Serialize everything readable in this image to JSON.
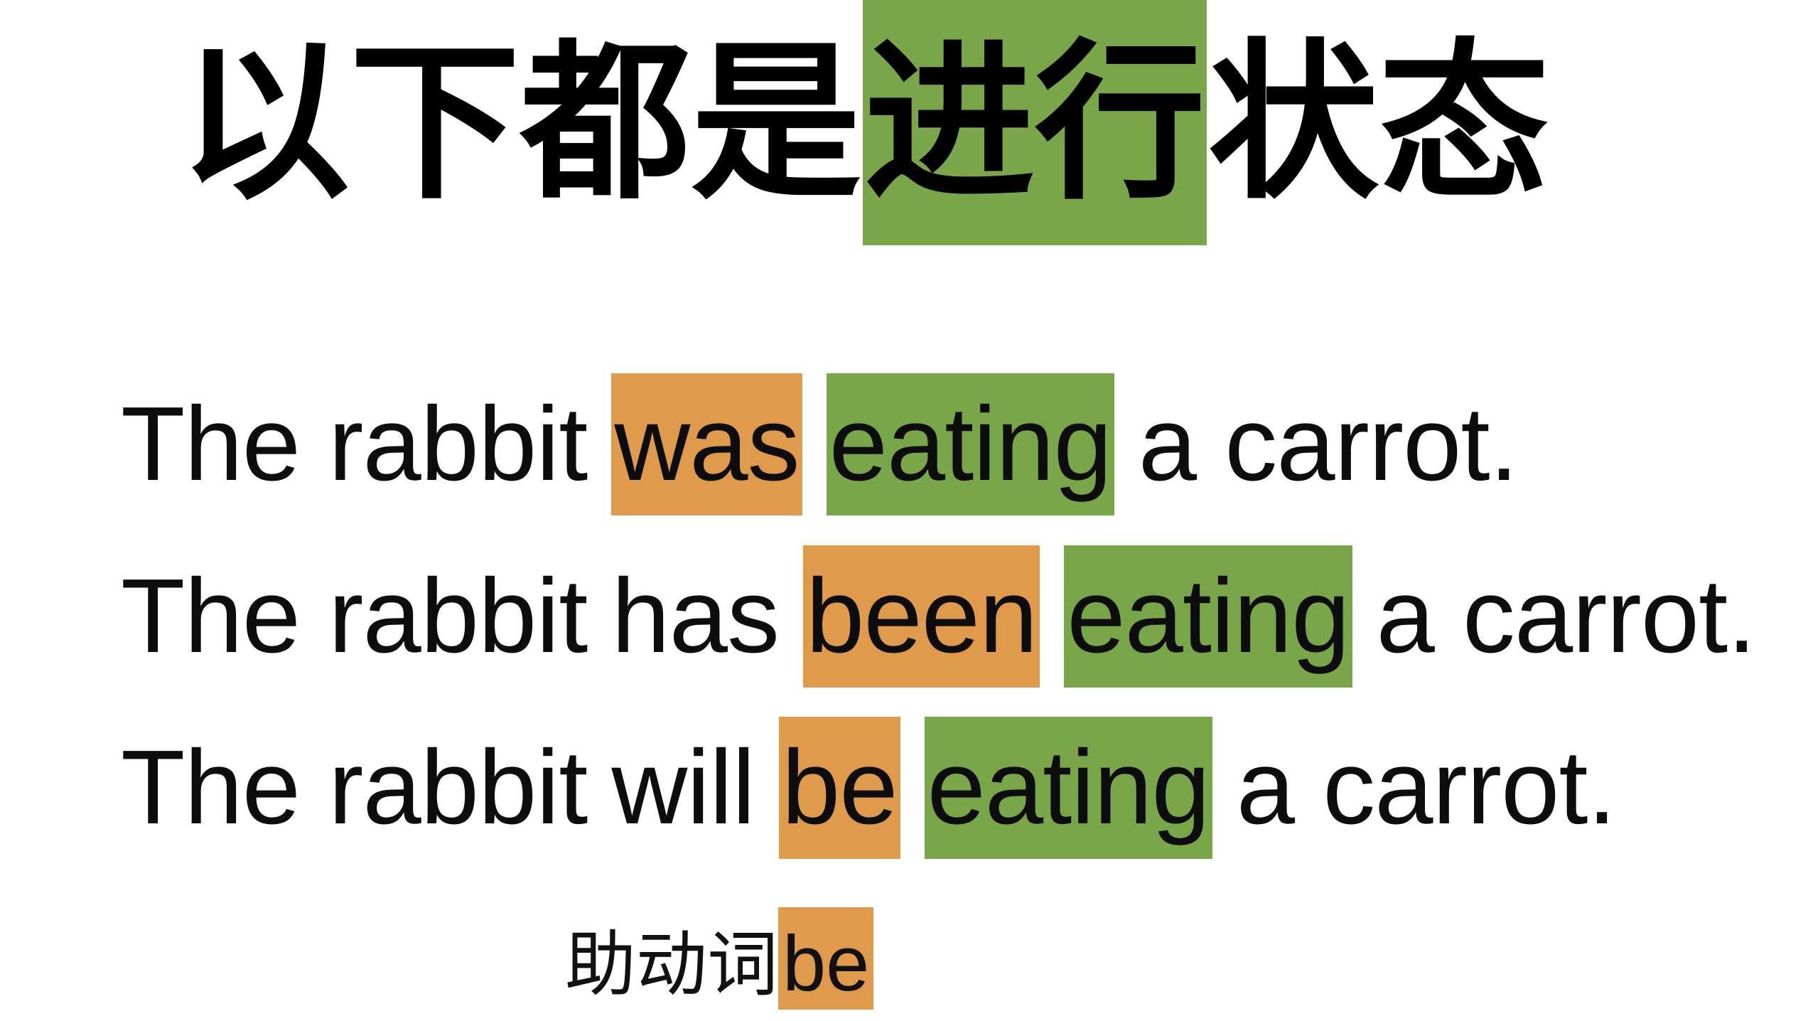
{
  "title": {
    "before": "以下都是",
    "highlight": "进行",
    "after": "状态"
  },
  "sentences": [
    {
      "subject": "The rabbit",
      "modal": "",
      "aux": "was",
      "verb": "eating",
      "object": "a carrot."
    },
    {
      "subject": "The rabbit",
      "modal": "has",
      "aux": "been",
      "verb": "eating",
      "object": "a carrot."
    },
    {
      "subject": "The rabbit",
      "modal": "will",
      "aux": "be",
      "verb": "eating",
      "object": "a carrot."
    }
  ],
  "note": {
    "label": "助动词",
    "highlight": "be"
  },
  "colors": {
    "aux_highlight": "#df9a4c",
    "verb_highlight": "#7aa64a"
  }
}
